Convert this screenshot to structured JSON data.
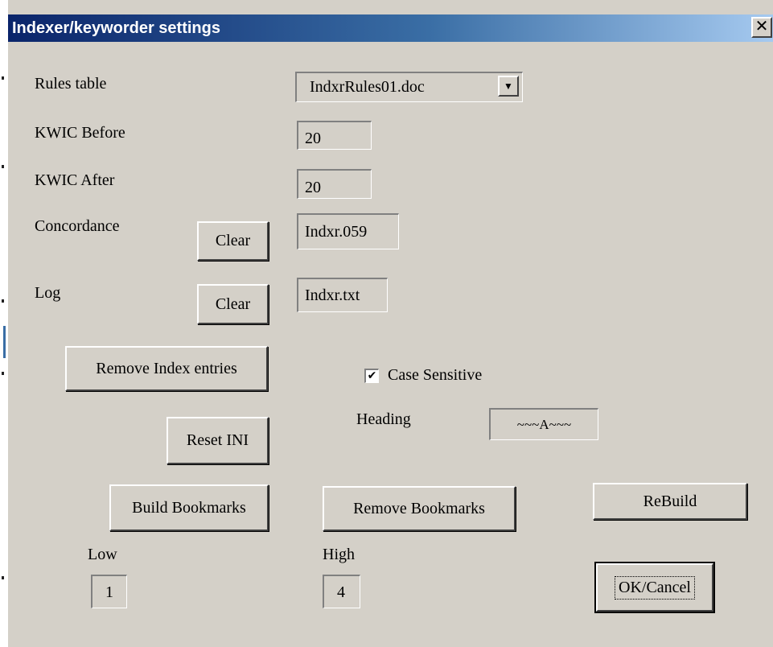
{
  "window": {
    "title": "Indexer/keyworder settings",
    "close_glyph": "✕"
  },
  "rules_table": {
    "label": "Rules table",
    "value": "IndxrRules01.doc",
    "arrow": "▼"
  },
  "kwic_before": {
    "label": "KWIC Before",
    "value": "20"
  },
  "kwic_after": {
    "label": "KWIC After",
    "value": "20"
  },
  "concordance": {
    "label": "Concordance",
    "clear_label": "Clear",
    "value": "Indxr.059"
  },
  "log": {
    "label": "Log",
    "clear_label": "Clear",
    "value": "Indxr.txt"
  },
  "remove_index_entries_label": "Remove Index entries",
  "case_sensitive": {
    "label": "Case Sensitive",
    "checked": true,
    "check_glyph": "✔"
  },
  "reset_ini_label": "Reset INI",
  "heading": {
    "label": "Heading",
    "value": "~~~A~~~"
  },
  "build_bookmarks_label": "Build Bookmarks",
  "remove_bookmarks_label": "Remove Bookmarks",
  "rebuild_label": "ReBuild",
  "low": {
    "label": "Low",
    "value": "1"
  },
  "high": {
    "label": "High",
    "value": "4"
  },
  "ok_cancel_label": "OK/Cancel"
}
